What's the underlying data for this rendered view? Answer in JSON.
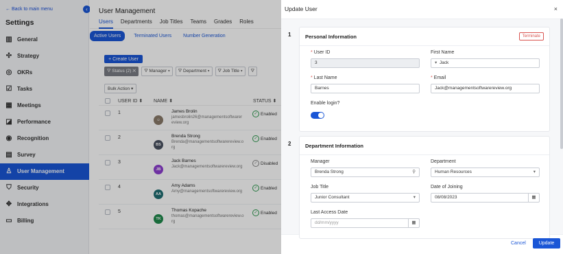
{
  "sidebar": {
    "back_link": "← Back to main menu",
    "title": "Settings",
    "items": [
      {
        "label": "General",
        "icon": "building-icon"
      },
      {
        "label": "Strategy",
        "icon": "strategy-icon"
      },
      {
        "label": "OKRs",
        "icon": "target-icon"
      },
      {
        "label": "Tasks",
        "icon": "tasks-icon"
      },
      {
        "label": "Meetings",
        "icon": "calendar-icon"
      },
      {
        "label": "Performance",
        "icon": "chart-icon"
      },
      {
        "label": "Recognition",
        "icon": "recognition-icon"
      },
      {
        "label": "Survey",
        "icon": "survey-icon"
      },
      {
        "label": "User Management",
        "icon": "user-icon",
        "active": true
      },
      {
        "label": "Security",
        "icon": "shield-icon"
      },
      {
        "label": "Integrations",
        "icon": "integrations-icon"
      },
      {
        "label": "Billing",
        "icon": "billing-icon"
      }
    ]
  },
  "main": {
    "title": "User Management",
    "tabs": [
      "Users",
      "Departments",
      "Job Titles",
      "Teams",
      "Grades",
      "Roles"
    ],
    "sub_tabs": [
      "Active Users",
      "Terminated Users",
      "Number Generation"
    ],
    "create_button": "Create User",
    "filters": [
      "Status (2)",
      "Manager",
      "Department",
      "Job Title",
      ""
    ],
    "bulk_action": "Bulk Action",
    "columns": [
      "USER ID",
      "NAME",
      "STATUS"
    ],
    "rows": [
      {
        "id": "1",
        "name": "James Brolin",
        "email": "jamesbrolin26@managementsoftwarereview.org",
        "status": "Enabled",
        "initials": "",
        "avatar_color": "#8a7a6a"
      },
      {
        "id": "2",
        "name": "Brenda Strong",
        "email": "Brenda@managementsoftwarereview.org",
        "status": "Enabled",
        "initials": "BS",
        "avatar_color": "#4a5160"
      },
      {
        "id": "3",
        "name": "Jack Barnes",
        "email": "Jack@managementsoftwarereview.org",
        "status": "Disabled",
        "initials": "JB",
        "avatar_color": "#8e3fd0"
      },
      {
        "id": "4",
        "name": "Amy Adams",
        "email": "Amy@managementsoftwarereview.org",
        "status": "Enabled",
        "initials": "AA",
        "avatar_color": "#1f6e72"
      },
      {
        "id": "5",
        "name": "Thomas Kopache",
        "email": "thomas@managementsoftwarereview.org",
        "status": "Enabled",
        "initials": "TK",
        "avatar_color": "#1f8a4c"
      }
    ]
  },
  "modal": {
    "title": "Update User",
    "close": "×",
    "section1": {
      "number": "1",
      "title": "Personal Information",
      "terminate": "Terminate",
      "user_id_label": "User ID",
      "user_id_value": "3",
      "first_name_label": "First Name",
      "first_name_value": "Jack",
      "last_name_label": "Last Name",
      "last_name_value": "Barnes",
      "email_label": "Email",
      "email_value": "Jack@managementsoftwarereview.org",
      "enable_login_label": "Enable login?",
      "enable_login_on": true
    },
    "section2": {
      "number": "2",
      "title": "Department Information",
      "manager_label": "Manager",
      "manager_value": "Brenda Strong",
      "department_label": "Department",
      "department_value": "Human Resources",
      "job_title_label": "Job Title",
      "job_title_value": "Junior Consultant",
      "date_joining_label": "Date of Joining",
      "date_joining_value": "08/08/2023",
      "last_access_label": "Last Access Date",
      "last_access_placeholder": "dd/mm/yyyy"
    },
    "cancel": "Cancel",
    "update": "Update"
  },
  "colors": {
    "accent": "#1a56d6",
    "danger": "#d9534f",
    "success": "#2e9a4f"
  }
}
